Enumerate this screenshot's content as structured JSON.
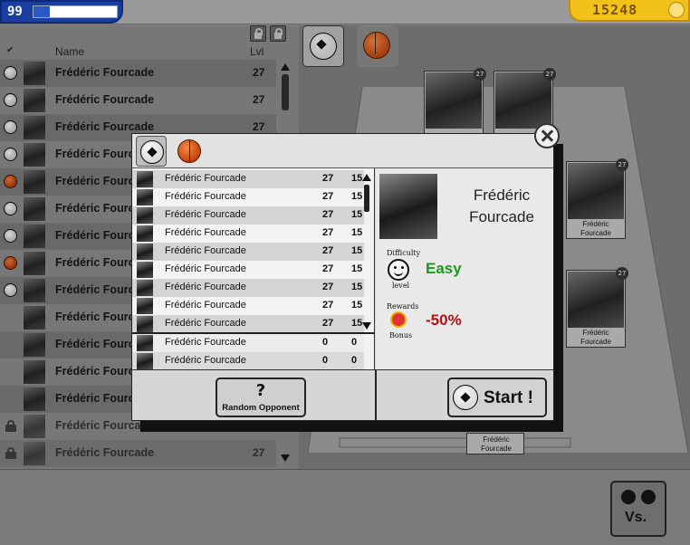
{
  "hud": {
    "xp_value": "99",
    "xp_fill": 0.2,
    "coins": "15248"
  },
  "left_list": {
    "col_name": "Name",
    "col_lvl": "Lvl",
    "rows": [
      {
        "sport": "football",
        "name": "Frédéric Fourcade",
        "lvl": "27",
        "locked": false
      },
      {
        "sport": "football",
        "name": "Frédéric Fourcade",
        "lvl": "27",
        "locked": false
      },
      {
        "sport": "football",
        "name": "Frédéric Fourcade",
        "lvl": "27",
        "locked": false
      },
      {
        "sport": "football",
        "name": "Frédéric Fourcade",
        "lvl": "",
        "locked": false
      },
      {
        "sport": "basketball",
        "name": "Frédéric Fourcade",
        "lvl": "",
        "locked": false
      },
      {
        "sport": "football",
        "name": "Frédéric Fourcade",
        "lvl": "",
        "locked": false
      },
      {
        "sport": "football",
        "name": "Frédéric Fourcade",
        "lvl": "",
        "locked": false
      },
      {
        "sport": "basketball",
        "name": "Frédéric Fourcade",
        "lvl": "",
        "locked": false
      },
      {
        "sport": "football",
        "name": "Frédéric Fourcade",
        "lvl": "",
        "locked": false
      },
      {
        "sport": "",
        "name": "Frédéric Fourcade",
        "lvl": "",
        "locked": false
      },
      {
        "sport": "",
        "name": "Frédéric Fourcade",
        "lvl": "",
        "locked": false
      },
      {
        "sport": "",
        "name": "Frédéric Fourcade",
        "lvl": "",
        "locked": false
      },
      {
        "sport": "",
        "name": "Frédéric Fourcade",
        "lvl": "",
        "locked": false
      },
      {
        "sport": "",
        "name": "Frédéric Fourcade",
        "lvl": "",
        "locked": true
      },
      {
        "sport": "",
        "name": "Frédéric Fourcade",
        "lvl": "27",
        "locked": true
      }
    ]
  },
  "field_cards": [
    {
      "name": "",
      "lvl": "27"
    },
    {
      "name": "",
      "lvl": "27"
    },
    {
      "name": "Frédéric Fourcade",
      "lvl": "27"
    },
    {
      "name": "Frédéric Fourcade",
      "lvl": "27"
    },
    {
      "name": "Frédéric Fourcade",
      "lvl": ""
    }
  ],
  "modal": {
    "rows": [
      {
        "name": "Frédéric Fourcade",
        "a": "27",
        "b": "15"
      },
      {
        "name": "Frédéric Fourcade",
        "a": "27",
        "b": "15"
      },
      {
        "name": "Frédéric Fourcade",
        "a": "27",
        "b": "15"
      },
      {
        "name": "Frédéric Fourcade",
        "a": "27",
        "b": "15"
      },
      {
        "name": "Frédéric Fourcade",
        "a": "27",
        "b": "15"
      },
      {
        "name": "Frédéric Fourcade",
        "a": "27",
        "b": "15"
      },
      {
        "name": "Frédéric Fourcade",
        "a": "27",
        "b": "15"
      },
      {
        "name": "Frédéric Fourcade",
        "a": "27",
        "b": "15"
      },
      {
        "name": "Frédéric Fourcade",
        "a": "27",
        "b": "15"
      }
    ],
    "extra_rows": [
      {
        "name": "Frédéric Fourcade",
        "a": "0",
        "b": "0"
      },
      {
        "name": "Frédéric Fourcade",
        "a": "0",
        "b": "0"
      }
    ],
    "detail": {
      "first_name": "Frédéric",
      "last_name": "Fourcade",
      "difficulty_top": "Difficulty",
      "difficulty_bottom": "level",
      "difficulty_value": "Easy",
      "rewards_top": "Rewards",
      "rewards_bottom": "Bonus",
      "bonus_value": "-50%"
    },
    "random_q": "?",
    "random_label": "Random Opponent",
    "start_label": "Start !"
  },
  "vs_label": "Vs."
}
